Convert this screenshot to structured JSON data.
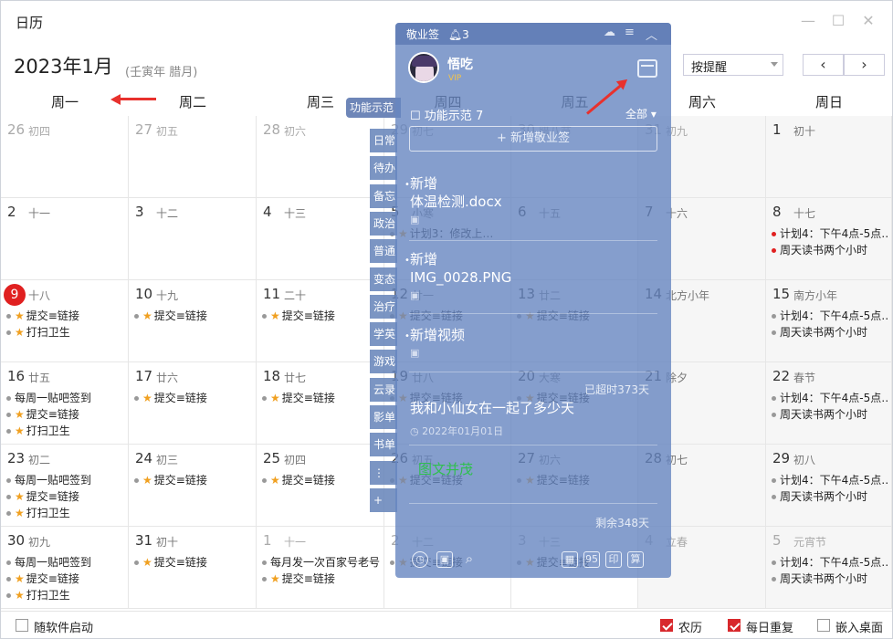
{
  "window": {
    "title": "日历"
  },
  "header": {
    "month": "2023年1月",
    "lunar_year": "(壬寅年 腊月)",
    "remind_select": "按提醒",
    "prev": "‹",
    "next": "›"
  },
  "weekdays": [
    "周一",
    "周二",
    "周三",
    "周四",
    "周五",
    "周六",
    "周日"
  ],
  "weeks": [
    [
      {
        "d": "26",
        "l": "初四",
        "o": true,
        "e": []
      },
      {
        "d": "27",
        "l": "初五",
        "o": true,
        "e": []
      },
      {
        "d": "28",
        "l": "初六",
        "o": true,
        "e": []
      },
      {
        "d": "29",
        "l": "初七",
        "o": true,
        "e": []
      },
      {
        "d": "30",
        "l": "腊八节",
        "o": true,
        "e": []
      },
      {
        "d": "31",
        "l": "初九",
        "o": true,
        "e": []
      },
      {
        "d": "1",
        "l": "初十",
        "o": false,
        "e": []
      }
    ],
    [
      {
        "d": "2",
        "l": "十一",
        "e": []
      },
      {
        "d": "3",
        "l": "十二",
        "e": []
      },
      {
        "d": "4",
        "l": "十三",
        "e": []
      },
      {
        "d": "5",
        "l": "小寒",
        "e": [
          {
            "t": "计划3：修改上…",
            "s": "star",
            "k": "gray"
          }
        ]
      },
      {
        "d": "6",
        "l": "十五",
        "e": []
      },
      {
        "d": "7",
        "l": "十六",
        "e": []
      },
      {
        "d": "8",
        "l": "十七",
        "e": [
          {
            "t": "计划4：下午4点-5点…",
            "s": "",
            "k": "red"
          },
          {
            "t": "周天读书两个小时",
            "s": "",
            "k": "red"
          }
        ]
      }
    ],
    [
      {
        "d": "9",
        "l": "十八",
        "today": true,
        "e": [
          {
            "t": "提交≡链接",
            "s": "star",
            "k": "gray"
          },
          {
            "t": "打扫卫生",
            "s": "star",
            "k": "gray"
          }
        ]
      },
      {
        "d": "10",
        "l": "十九",
        "e": [
          {
            "t": "提交≡链接",
            "s": "star",
            "k": "gray"
          }
        ]
      },
      {
        "d": "11",
        "l": "二十",
        "e": [
          {
            "t": "提交≡链接",
            "s": "star",
            "k": "gray"
          }
        ]
      },
      {
        "d": "12",
        "l": "廿一",
        "e": [
          {
            "t": "提交≡链接",
            "s": "star",
            "k": "gray"
          }
        ]
      },
      {
        "d": "13",
        "l": "廿二",
        "e": [
          {
            "t": "提交≡链接",
            "s": "star",
            "k": "gray"
          }
        ]
      },
      {
        "d": "14",
        "l": "北方小年",
        "e": []
      },
      {
        "d": "15",
        "l": "南方小年",
        "e": [
          {
            "t": "计划4：下午4点-5点…",
            "s": "",
            "k": "gray"
          },
          {
            "t": "周天读书两个小时",
            "s": "",
            "k": "gray"
          }
        ]
      }
    ],
    [
      {
        "d": "16",
        "l": "廿五",
        "e": [
          {
            "t": "每周一贴吧签到",
            "s": "",
            "k": "gray"
          },
          {
            "t": "提交≡链接",
            "s": "star",
            "k": "gray"
          },
          {
            "t": "打扫卫生",
            "s": "star",
            "k": "gray"
          }
        ]
      },
      {
        "d": "17",
        "l": "廿六",
        "e": [
          {
            "t": "提交≡链接",
            "s": "star",
            "k": "gray"
          }
        ]
      },
      {
        "d": "18",
        "l": "廿七",
        "e": [
          {
            "t": "提交≡链接",
            "s": "star",
            "k": "gray"
          }
        ]
      },
      {
        "d": "19",
        "l": "廿八",
        "e": [
          {
            "t": "提交≡链接",
            "s": "star",
            "k": "gray"
          }
        ]
      },
      {
        "d": "20",
        "l": "大寒",
        "e": [
          {
            "t": "提交≡链接",
            "s": "star",
            "k": "gray"
          }
        ]
      },
      {
        "d": "21",
        "l": "除夕",
        "e": []
      },
      {
        "d": "22",
        "l": "春节",
        "e": [
          {
            "t": "计划4：下午4点-5点…",
            "s": "",
            "k": "gray"
          },
          {
            "t": "周天读书两个小时",
            "s": "",
            "k": "gray"
          }
        ]
      }
    ],
    [
      {
        "d": "23",
        "l": "初二",
        "e": [
          {
            "t": "每周一贴吧签到",
            "s": "",
            "k": "gray"
          },
          {
            "t": "提交≡链接",
            "s": "star",
            "k": "gray"
          },
          {
            "t": "打扫卫生",
            "s": "star",
            "k": "gray"
          }
        ]
      },
      {
        "d": "24",
        "l": "初三",
        "e": [
          {
            "t": "提交≡链接",
            "s": "star",
            "k": "gray"
          }
        ]
      },
      {
        "d": "25",
        "l": "初四",
        "e": [
          {
            "t": "提交≡链接",
            "s": "star",
            "k": "gray"
          }
        ]
      },
      {
        "d": "26",
        "l": "初五",
        "e": [
          {
            "t": "提交≡链接",
            "s": "star",
            "k": "gray"
          }
        ]
      },
      {
        "d": "27",
        "l": "初六",
        "e": [
          {
            "t": "提交≡链接",
            "s": "star",
            "k": "gray"
          }
        ]
      },
      {
        "d": "28",
        "l": "初七",
        "e": []
      },
      {
        "d": "29",
        "l": "初八",
        "e": [
          {
            "t": "计划4：下午4点-5点…",
            "s": "",
            "k": "gray"
          },
          {
            "t": "周天读书两个小时",
            "s": "",
            "k": "gray"
          }
        ]
      }
    ],
    [
      {
        "d": "30",
        "l": "初九",
        "e": [
          {
            "t": "每周一贴吧签到",
            "s": "",
            "k": "gray"
          },
          {
            "t": "提交≡链接",
            "s": "star",
            "k": "gray"
          },
          {
            "t": "打扫卫生",
            "s": "star",
            "k": "gray"
          }
        ]
      },
      {
        "d": "31",
        "l": "初十",
        "e": [
          {
            "t": "提交≡链接",
            "s": "star",
            "k": "gray"
          }
        ]
      },
      {
        "d": "1",
        "l": "十一",
        "o": true,
        "e": [
          {
            "t": "每月发一次百家号老号",
            "s": "",
            "k": "gray"
          },
          {
            "t": "提交≡链接",
            "s": "star",
            "k": "gray"
          }
        ]
      },
      {
        "d": "2",
        "l": "十二",
        "o": true,
        "e": [
          {
            "t": "提交≡链接",
            "s": "star",
            "k": "gray"
          }
        ]
      },
      {
        "d": "3",
        "l": "十三",
        "o": true,
        "e": [
          {
            "t": "提交≡链接",
            "s": "star",
            "k": "gray"
          }
        ]
      },
      {
        "d": "4",
        "l": "立春",
        "o": true,
        "e": []
      },
      {
        "d": "5",
        "l": "元宵节",
        "o": true,
        "e": [
          {
            "t": "计划4：下午4点-5点…",
            "s": "",
            "k": "gray"
          },
          {
            "t": "周天读书两个小时",
            "s": "",
            "k": "gray"
          }
        ]
      }
    ]
  ],
  "side_tabs": [
    "功能示范",
    "日常",
    "待办",
    "备忘",
    "政治",
    "普通",
    "变态",
    "治疗",
    "学英",
    "游戏",
    "云录",
    "影单",
    "书单",
    "⋮",
    "+"
  ],
  "panel": {
    "title": "敬业签",
    "count": "3",
    "user": "悟吃",
    "vip": "VIP",
    "filter": "功能示范",
    "filter_count": "7",
    "all": "全部",
    "add": "+ 新增敬业签",
    "notes": [
      {
        "title": "新增",
        "sub": "体温检测.docx"
      },
      {
        "title": "新增",
        "sub": "IMG_0028.PNG"
      },
      {
        "title": "新增视频",
        "sub": ""
      }
    ],
    "timer_overdue": "已超时373天",
    "timer_title": "我和小仙女在一起了多少天",
    "timer_date": "2022年01月01日",
    "green": "图文并茂",
    "remain": "剩余348天",
    "bottom_icons": [
      "95",
      "印",
      "算"
    ]
  },
  "footer": {
    "autostart": "随软件启动",
    "lunar": "农历",
    "daily": "每日重复",
    "embed": "嵌入桌面"
  }
}
